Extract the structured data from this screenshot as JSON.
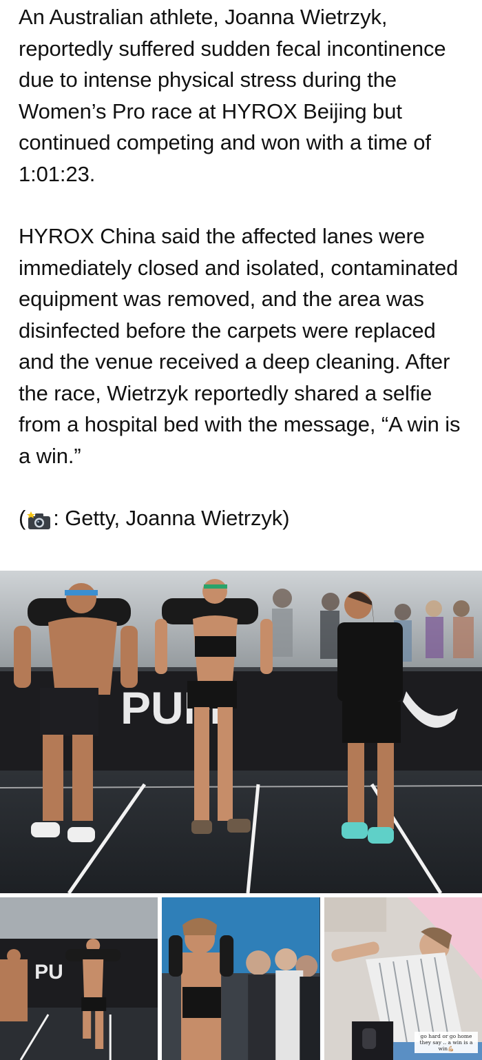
{
  "post": {
    "paragraph1": "An Australian athlete, Joanna Wietrzyk, reportedly suffered sudden fecal incontinence due to intense physical stress during the Women’s Pro race at HYROX Beijing but continued competing and won with a time of 1:01:23.",
    "paragraph2": "HYROX China said the affected lanes were immediately closed and isolated, contaminated equipment was removed, and the area was disinfected before the carpets were replaced and the venue received a deep cleaning. After the race, Wietrzyk reportedly shared a selfie from a hospital bed with the message, “A win is a win.”",
    "credit_open": "(",
    "credit_text": ": Getty, Joanna Wietrzyk)"
  },
  "photos": {
    "main": {
      "banner_text": "PUM",
      "icon": "race-photo"
    },
    "small1": {
      "banner_text": "PU",
      "icon": "race-photo"
    },
    "small2": {
      "icon": "crowd-photo"
    },
    "small3": {
      "icon": "hospital-selfie-photo",
      "caption": "go hard or go home they say .. a win is a win💪🏼"
    }
  },
  "colors": {
    "text": "#111111",
    "background": "#ffffff",
    "arena_floor": "#2b2e33",
    "banner": "#1c1c1f"
  }
}
